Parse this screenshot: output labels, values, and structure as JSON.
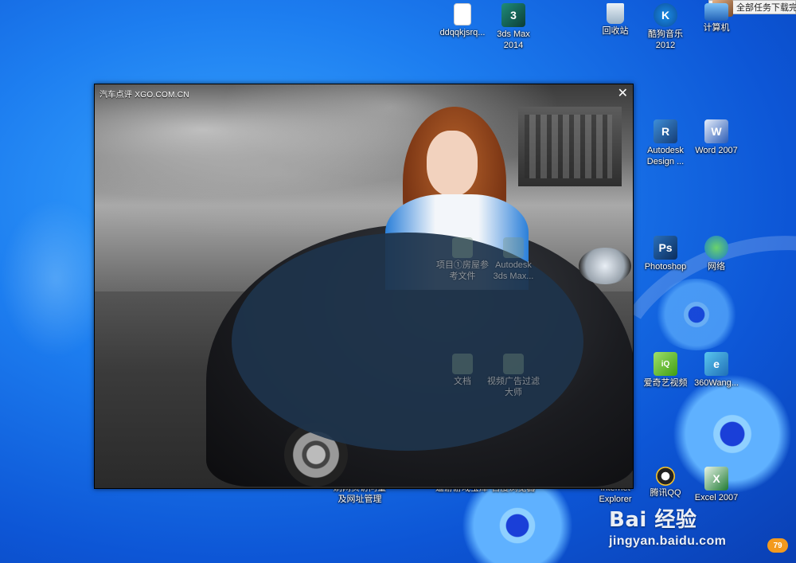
{
  "tray": {
    "text": "全部任务下载完"
  },
  "desktop_icons": [
    {
      "label": "ddqqkjsrq..."
    },
    {
      "label": "3ds Max\n2014"
    },
    {
      "label": "回收站"
    },
    {
      "label": "酷狗音乐\n2012"
    },
    {
      "label": "计算机"
    },
    {
      "label": "Autodesk\nDesign ..."
    },
    {
      "label": "Word 2007"
    },
    {
      "label": "Photoshop"
    },
    {
      "label": "网络"
    },
    {
      "label": "爱奇艺视频"
    },
    {
      "label": "360Wang..."
    },
    {
      "label": "刷网页访问量\n及网址管理"
    },
    {
      "label": "逗游游戏宝库"
    },
    {
      "label": "百度浏览器"
    },
    {
      "label": "Internet\nExplorer"
    },
    {
      "label": "腾讯QQ"
    },
    {
      "label": "Excel 2007"
    }
  ],
  "popup": {
    "title": "汽车点评  XGO.COM.CN",
    "close": "✕"
  },
  "ghost_icons": [
    {
      "label": "项目①房屋参\n考文件"
    },
    {
      "label": "Autodesk\n3ds Max..."
    },
    {
      "label": "文档"
    },
    {
      "label": "视频广告过滤\n大师"
    }
  ],
  "watermark": {
    "logo": "Bai 经验",
    "url": "jingyan.baidu.com"
  },
  "net_badge": "79"
}
